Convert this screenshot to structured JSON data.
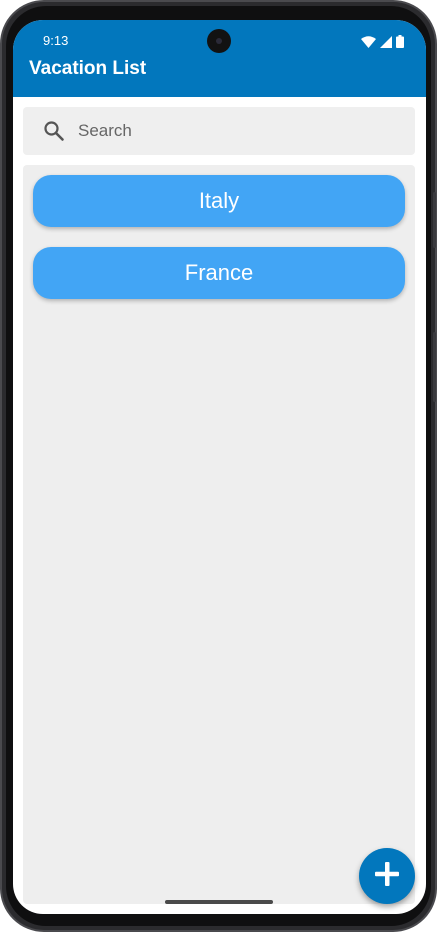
{
  "status_bar": {
    "time": "9:13",
    "icons": [
      "wifi-icon",
      "cellular-signal-icon",
      "battery-icon"
    ]
  },
  "app_bar": {
    "title": "Vacation List",
    "background_color": "#0277bd"
  },
  "search": {
    "placeholder": "Search",
    "value": "",
    "icon": "search-icon"
  },
  "vacations": [
    {
      "name": "Italy"
    },
    {
      "name": "France"
    }
  ],
  "colors": {
    "accent": "#0277bd",
    "item_background": "#42a5f5",
    "list_background": "#eeeeee"
  },
  "fab": {
    "icon": "plus-icon"
  }
}
